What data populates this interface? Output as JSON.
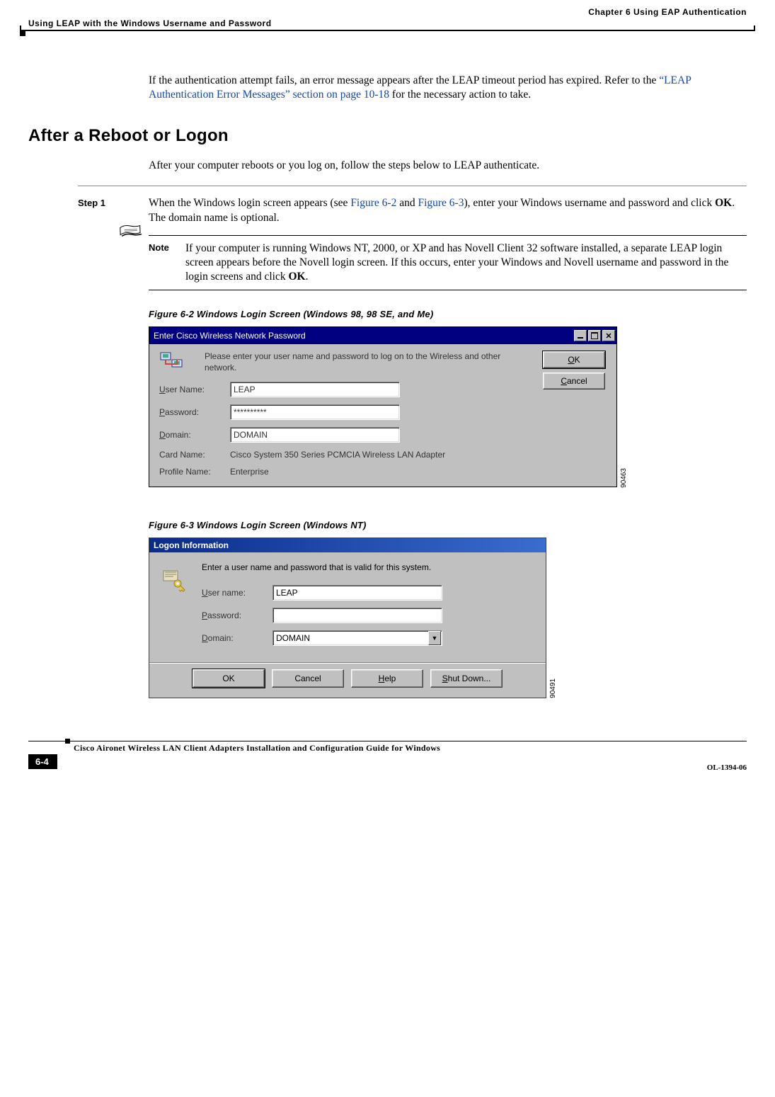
{
  "header": {
    "chapter": "Chapter 6      Using EAP Authentication",
    "section": "Using LEAP with the Windows Username and Password"
  },
  "intro_para": {
    "text1": "If the authentication attempt fails, an error message appears after the LEAP timeout period has expired. Refer to the ",
    "link": "“LEAP Authentication Error Messages” section on page 10-18",
    "text2": " for the necessary action to take."
  },
  "h2": "After a Reboot or Logon",
  "after_para": "After your computer reboots or you log on, follow the steps below to LEAP authenticate.",
  "step1": {
    "label": "Step 1",
    "text1": "When the Windows login screen appears (see ",
    "link1": "Figure 6-2",
    "text2": " and ",
    "link2": "Figure 6-3",
    "text3": "), enter your Windows username and password and click ",
    "bold1": "OK",
    "text4": ". The domain name is optional."
  },
  "note": {
    "label": "Note",
    "text1": "If your computer is running Windows NT, 2000, or XP and has Novell Client 32 software installed, a separate LEAP login screen appears before the Novell login screen. If this occurs, enter your Windows and Novell username and password in the login screens and click ",
    "bold1": "OK",
    "text2": "."
  },
  "fig62": {
    "caption": "Figure 6-2     Windows Login Screen (Windows 98, 98 SE, and Me)",
    "title": "Enter Cisco Wireless Network Password",
    "msg": "Please enter your user name and password to log on to the Wireless and other network.",
    "ok": "OK",
    "ok_u": "O",
    "ok_rest": "K",
    "cancel_u": "C",
    "cancel_rest": "ancel",
    "user_u": "U",
    "user_rest": "ser Name:",
    "pass_u": "P",
    "pass_rest": "assword:",
    "domain_u": "D",
    "domain_rest": "omain:",
    "user_val": "LEAP",
    "pass_val": "**********",
    "domain_val": "DOMAIN",
    "card_label": "Card Name:",
    "card_val": "Cisco System 350 Series PCMCIA Wireless LAN Adapter",
    "profile_label": "Profile Name:",
    "profile_val": "Enterprise",
    "img_id": "90463"
  },
  "fig63": {
    "caption": "Figure 6-3     Windows Login Screen (Windows NT)",
    "title": "Logon Information",
    "msg": "Enter a user name and password that is valid for this system.",
    "user_u": "U",
    "user_rest": "ser name:",
    "pass_u": "P",
    "pass_rest": "assword:",
    "domain_u": "D",
    "domain_rest": "omain:",
    "user_val": "LEAP",
    "pass_val": "",
    "domain_val": "DOMAIN",
    "ok": "OK",
    "cancel": "Cancel",
    "help_u": "H",
    "help_rest": "elp",
    "shut_u": "S",
    "shut_rest": "hut Down...",
    "img_id": "90491"
  },
  "footer": {
    "title": "Cisco Aironet Wireless LAN Client Adapters Installation and Configuration Guide for Windows",
    "page": "6-4",
    "docid": "OL-1394-06"
  }
}
